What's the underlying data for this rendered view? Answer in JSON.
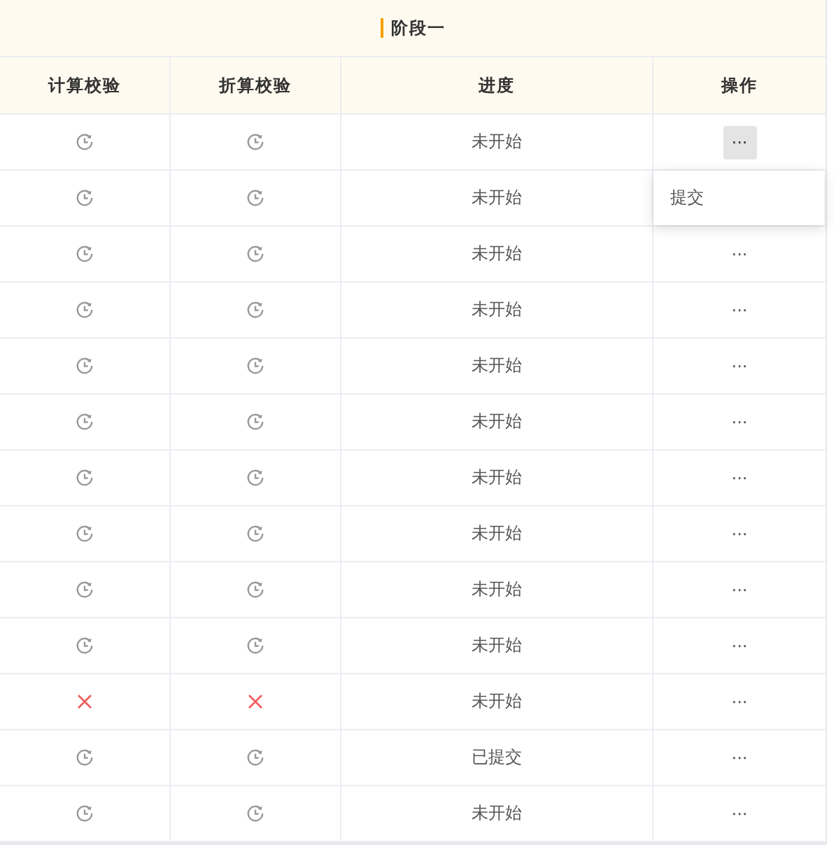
{
  "stage": {
    "title": "阶段一"
  },
  "columns": [
    "计算校验",
    "折算校验",
    "进度",
    "操作"
  ],
  "rows": [
    {
      "calc": {
        "kind": "pending"
      },
      "convert": {
        "kind": "pending"
      },
      "progress": "未开始",
      "action": "···",
      "selected": true
    },
    {
      "calc": {
        "kind": "pending"
      },
      "convert": {
        "kind": "pending"
      },
      "progress": "未开始"
    },
    {
      "calc": {
        "kind": "pending"
      },
      "convert": {
        "kind": "pending"
      },
      "progress": "未开始",
      "action": "···",
      "selected": false
    },
    {
      "calc": {
        "kind": "pending"
      },
      "convert": {
        "kind": "pending"
      },
      "progress": "未开始",
      "action": "···",
      "selected": false
    },
    {
      "calc": {
        "kind": "pending"
      },
      "convert": {
        "kind": "pending"
      },
      "progress": "未开始",
      "action": "···",
      "selected": false
    },
    {
      "calc": {
        "kind": "pending"
      },
      "convert": {
        "kind": "pending"
      },
      "progress": "未开始",
      "action": "···",
      "selected": false
    },
    {
      "calc": {
        "kind": "pending"
      },
      "convert": {
        "kind": "pending"
      },
      "progress": "未开始",
      "action": "···",
      "selected": false
    },
    {
      "calc": {
        "kind": "pending"
      },
      "convert": {
        "kind": "pending"
      },
      "progress": "未开始",
      "action": "···",
      "selected": false
    },
    {
      "calc": {
        "kind": "pending"
      },
      "convert": {
        "kind": "pending"
      },
      "progress": "未开始",
      "action": "···",
      "selected": false
    },
    {
      "calc": {
        "kind": "pending"
      },
      "convert": {
        "kind": "pending"
      },
      "progress": "未开始",
      "action": "···",
      "selected": false
    },
    {
      "calc": {
        "kind": "failed"
      },
      "convert": {
        "kind": "failed"
      },
      "progress": "未开始",
      "action": "···",
      "selected": false
    },
    {
      "calc": {
        "kind": "pending"
      },
      "convert": {
        "kind": "pending"
      },
      "progress": "已提交",
      "action": "···",
      "selected": false
    },
    {
      "calc": {
        "kind": "pending"
      },
      "convert": {
        "kind": "pending"
      },
      "progress": "未开始",
      "action": "···",
      "selected": false
    }
  ],
  "menu": {
    "items": [
      "提交"
    ]
  }
}
